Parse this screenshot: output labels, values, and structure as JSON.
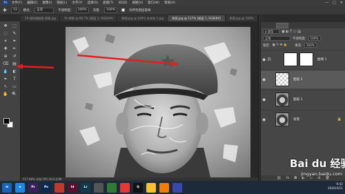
{
  "menubar": {
    "logo": "Ps",
    "items": [
      "文件(F)",
      "编辑(E)",
      "图像(I)",
      "图层(L)",
      "文字(Y)",
      "选择(S)",
      "滤镜(T)",
      "3D(D)",
      "视图(V)",
      "窗口(W)",
      "帮助(H)"
    ],
    "window_controls": [
      "—",
      "□",
      "✕"
    ]
  },
  "optbar": {
    "mode_label": "模式:",
    "mode_value": "正常",
    "size_value": "13",
    "opacity_label": "不透明度:",
    "opacity_value": "100%",
    "flow_label": "流量:",
    "flow_value": "100%",
    "checkbox_label": "对所有图层取样"
  },
  "tabs": [
    {
      "label": "1P-我的相册图 原图.jpg",
      "active": false
    },
    {
      "label": "Ps-原图 @ 66.7% (图层 1, RGB/8#)",
      "active": false
    },
    {
      "label": "原图.jpg @ 100% 未命名-1.jpg",
      "active": false
    },
    {
      "label": "原图.jpg @ 117% (图层 1, RGB/8#)",
      "active": true
    },
    {
      "label": "原图.jpg @ 100%",
      "active": false
    }
  ],
  "toolbox": {
    "tools": [
      "move-tool",
      "marquee-tool",
      "lasso-tool",
      "quick-select-tool",
      "crop-tool",
      "eyedropper-tool",
      "healing-tool",
      "brush-tool",
      "clone-stamp-tool",
      "history-brush-tool",
      "eraser-tool",
      "gradient-tool",
      "blur-tool",
      "dodge-tool",
      "pen-tool",
      "type-tool",
      "path-select-tool",
      "shape-tool",
      "hand-tool",
      "zoom-tool"
    ],
    "glyphs": [
      "✥",
      "⬚",
      "◌",
      "✎",
      "⌗",
      "✒",
      "✚",
      "✏",
      "⊕",
      "↺",
      "⌫",
      "▤",
      "💧",
      "◐",
      "✒",
      "T",
      "↖",
      "▭",
      "✋",
      "🔍"
    ]
  },
  "statusbar": {
    "text": "117.98%   文档:785.1K/3.03M"
  },
  "layers_panel": {
    "filter_label": "ρ 类型",
    "blend_mode": "正常",
    "opacity_label": "不透明度:",
    "opacity_value": "100%",
    "lock_label": "锁定:",
    "fill_label": "填充:",
    "fill_value": "100%",
    "layers": [
      {
        "name": "曲线 1",
        "visible": true,
        "selected": false,
        "kind": "adjustment"
      },
      {
        "name": "图层 2",
        "visible": true,
        "selected": true,
        "kind": "transparent"
      },
      {
        "name": "图层 1",
        "visible": true,
        "selected": false,
        "kind": "photo"
      },
      {
        "name": "背景",
        "visible": true,
        "selected": false,
        "kind": "photo"
      }
    ],
    "bottom_icons": [
      "link-icon",
      "fx-icon",
      "mask-icon",
      "adjustment-icon",
      "folder-icon",
      "new-layer-icon",
      "trash-icon"
    ]
  },
  "watermark": {
    "brand": "Bai du 经验",
    "url": "jingyan.baidu.com"
  },
  "taskbar": {
    "apps": [
      {
        "name": "ie-icon",
        "label": "e",
        "color": "#1e88e5"
      },
      {
        "name": "premiere-icon",
        "label": "Pr",
        "color": "#3a1f5c"
      },
      {
        "name": "photoshop-icon",
        "label": "Ps",
        "color": "#0a2a4f"
      },
      {
        "name": "app-icon-4",
        "label": "",
        "color": "#c0392b"
      },
      {
        "name": "indesign-icon",
        "label": "Id",
        "color": "#5a0f2e"
      },
      {
        "name": "lightroom-icon",
        "label": "Lr",
        "color": "#123a4a"
      },
      {
        "name": "app-icon-7",
        "label": "",
        "color": "#555555"
      },
      {
        "name": "app-icon-8",
        "label": "",
        "color": "#2e7d32"
      },
      {
        "name": "app-icon-9",
        "label": "",
        "color": "#e53935"
      },
      {
        "name": "qq-icon",
        "label": "Q",
        "color": "#111111"
      },
      {
        "name": "chrome-icon",
        "label": "",
        "color": "#fbc02d"
      },
      {
        "name": "app-icon-12",
        "label": "",
        "color": "#f57c00"
      },
      {
        "name": "explorer-icon",
        "label": "",
        "color": "#3949ab"
      }
    ],
    "time": "9:42",
    "date": "2020/4/11"
  },
  "annotations": {
    "arrow_color": "#e0201e"
  }
}
